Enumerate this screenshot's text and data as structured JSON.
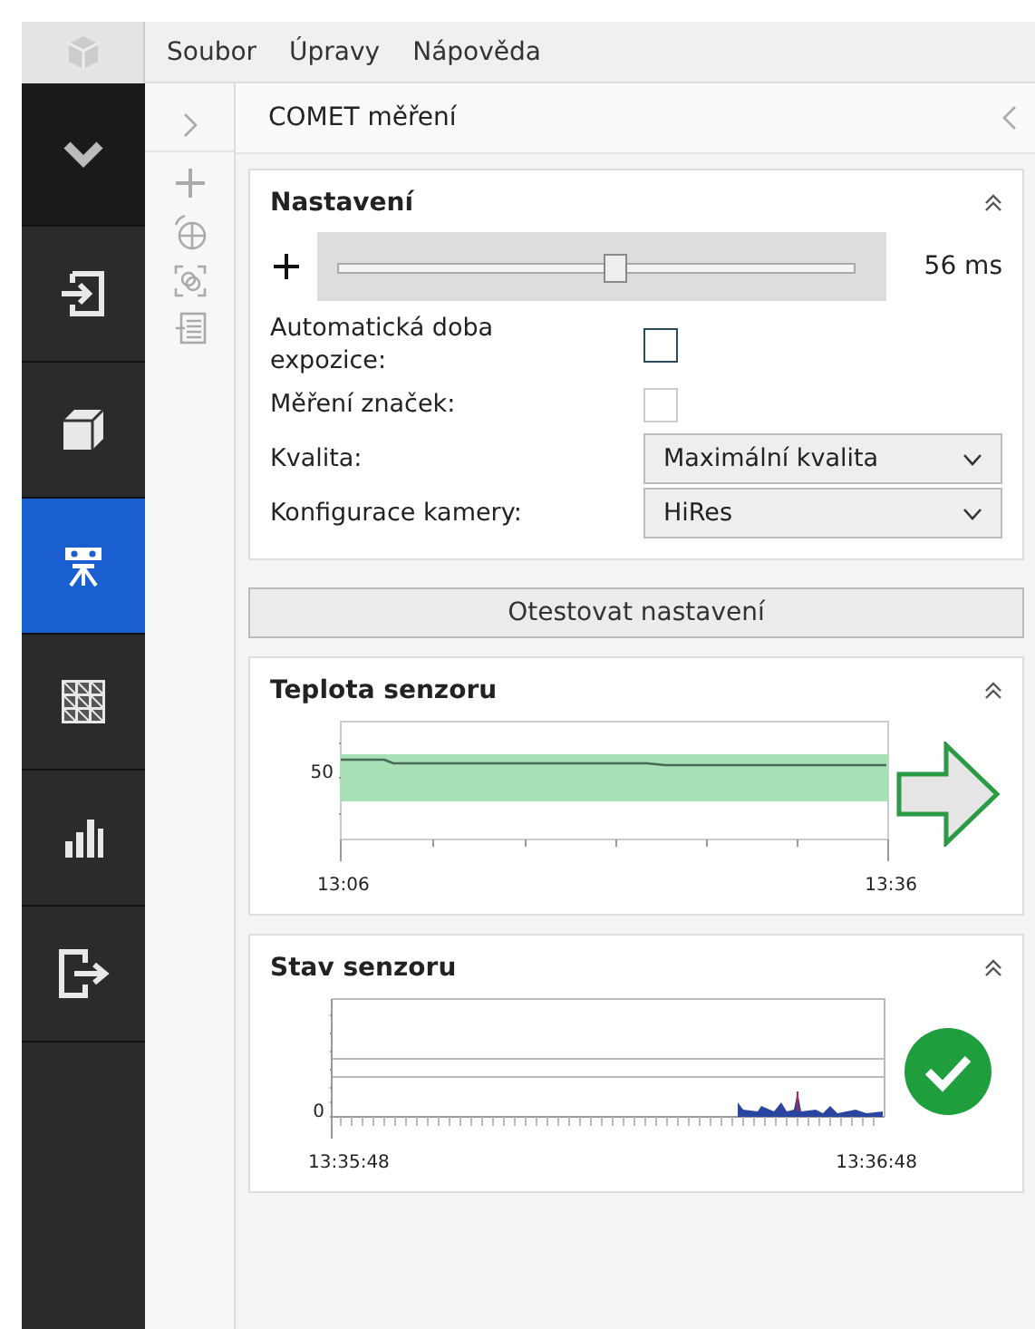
{
  "menu": [
    {
      "label": "Soubor"
    },
    {
      "label": "Úpravy"
    },
    {
      "label": "Nápověda"
    }
  ],
  "sidebar": {
    "items": [
      {
        "kind": "collapse",
        "selected": false
      },
      {
        "kind": "import",
        "selected": false
      },
      {
        "kind": "cube",
        "selected": false
      },
      {
        "kind": "camera",
        "selected": true
      },
      {
        "kind": "grid",
        "selected": false
      },
      {
        "kind": "chart",
        "selected": false
      },
      {
        "kind": "exit",
        "selected": false
      }
    ]
  },
  "panel": {
    "title": "COMET měření"
  },
  "settings": {
    "title": "Nastavení",
    "exposure": {
      "level": 0.535,
      "reading": "56 ms"
    },
    "fields": [
      {
        "kind": "checkbox",
        "label": "Automatická doba expozice:",
        "checked": false,
        "disabled": false
      },
      {
        "kind": "checkbox",
        "label": "Měření značek:",
        "checked": false,
        "disabled": true
      },
      {
        "kind": "select",
        "label": "Kvalita:",
        "value": "Maximální kvalita"
      },
      {
        "kind": "select",
        "label": "Konfigurace kamery:",
        "value": "HiRes"
      }
    ]
  },
  "test_button": {
    "label": "Otestovat nastavení"
  },
  "temperature": {
    "title": "Teplota senzoru",
    "y_tick": "50",
    "x_start": "13:06",
    "x_end": "13:36"
  },
  "status": {
    "title": "Stav senzoru",
    "y_tick": "0",
    "x_start": "13:35:48",
    "x_end": "13:36:48",
    "ok": true
  }
}
